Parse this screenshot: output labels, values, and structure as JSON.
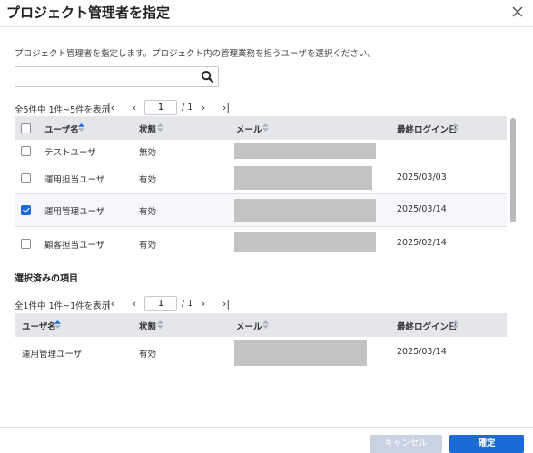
{
  "dialog": {
    "title": "プロジェクト管理者を指定",
    "description": "プロジェクト管理者を指定します。プロジェクト内の管理業務を担うユーザを選択ください。"
  },
  "search": {
    "value": "",
    "placeholder": ""
  },
  "pager_top": {
    "count_text": "全5件中 1件~5件を表示",
    "page": "1",
    "total": "/ 1"
  },
  "columns": [
    "ユーザ名",
    "状態",
    "メール",
    "最終ログイン日"
  ],
  "users": [
    {
      "name": "テストユーザ",
      "status": "無効",
      "email": "",
      "last_login": "",
      "checked": false
    },
    {
      "name": "運用担当ユーザ",
      "status": "有効",
      "email": "",
      "last_login": "2025/03/03",
      "checked": false
    },
    {
      "name": "運用管理ユーザ",
      "status": "有効",
      "email": "",
      "last_login": "2025/03/14",
      "checked": true
    },
    {
      "name": "顧客担当ユーザ",
      "status": "有効",
      "email": "",
      "last_login": "2025/02/14",
      "checked": false
    }
  ],
  "selected_section": {
    "title": "選択済みの項目"
  },
  "pager_bottom": {
    "count_text": "全1件中 1件~1件を表示",
    "page": "1",
    "total": "/ 1"
  },
  "selected_rows": [
    {
      "name": "運用管理ユーザ",
      "status": "有効",
      "email": "",
      "last_login": "2025/03/14"
    }
  ],
  "footer": {
    "cancel_label": "キャンセル",
    "ok_label": "確定"
  },
  "colors": {
    "primary": "#1a6ad8",
    "cancel": "#c9d2e0",
    "header_bg": "#e4e6ea",
    "sort_active": "#1a6ad8"
  }
}
